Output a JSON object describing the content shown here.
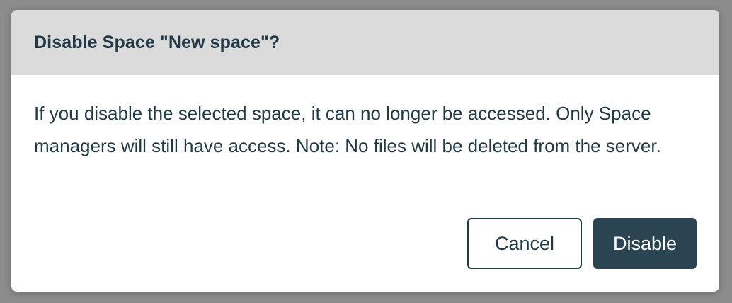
{
  "dialog": {
    "title": "Disable Space \"New space\"?",
    "message": "If you disable the selected space, it can no longer be accessed. Only Space managers will still have access. Note: No files will be deleted from the server.",
    "cancel_label": "Cancel",
    "confirm_label": "Disable"
  },
  "colors": {
    "backdrop": "#8c8c8c",
    "header_bg": "#dbdbdb",
    "text": "#223a46",
    "primary": "#2a4451"
  }
}
